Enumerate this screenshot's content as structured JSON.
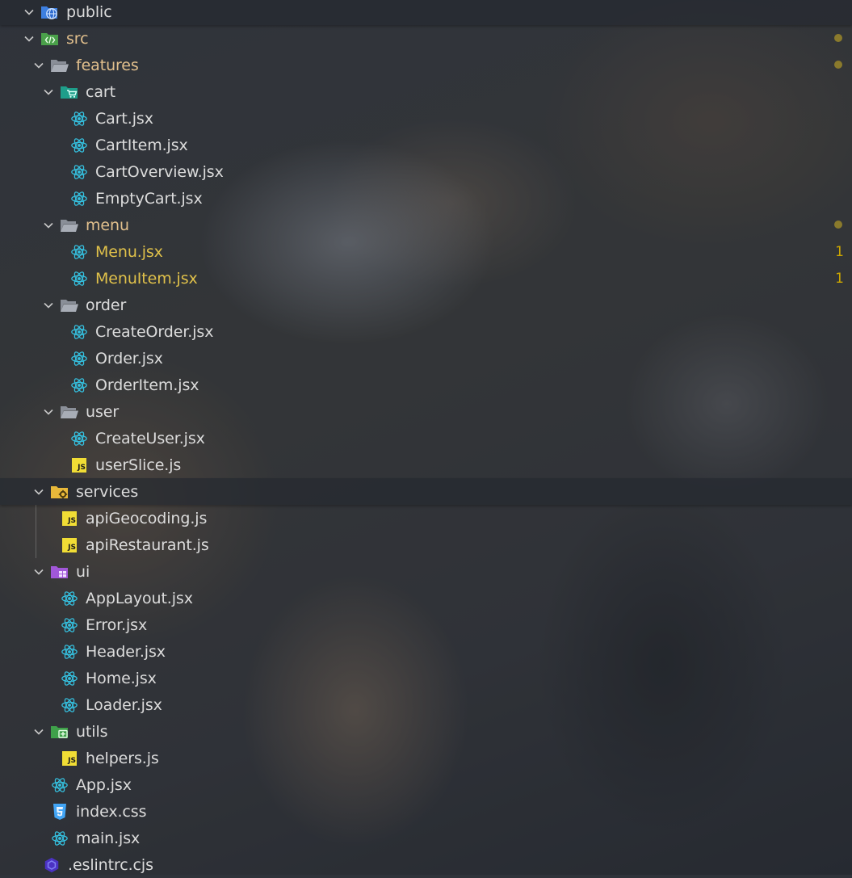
{
  "explorer": {
    "items": [
      {
        "label": "public",
        "type": "folder-public",
        "expanded": true,
        "depth": 0,
        "state": "normal"
      },
      {
        "label": "src",
        "type": "folder-src",
        "expanded": true,
        "depth": 0,
        "state": "modified"
      },
      {
        "label": "features",
        "type": "folder",
        "expanded": true,
        "depth": 1,
        "state": "modified"
      },
      {
        "label": "cart",
        "type": "folder-cart",
        "expanded": true,
        "depth": 2,
        "state": "normal"
      },
      {
        "label": "Cart.jsx",
        "type": "react",
        "depth": 3,
        "state": "normal"
      },
      {
        "label": "CartItem.jsx",
        "type": "react",
        "depth": 3,
        "state": "normal"
      },
      {
        "label": "CartOverview.jsx",
        "type": "react",
        "depth": 3,
        "state": "normal"
      },
      {
        "label": "EmptyCart.jsx",
        "type": "react",
        "depth": 3,
        "state": "normal"
      },
      {
        "label": "menu",
        "type": "folder",
        "expanded": true,
        "depth": 2,
        "state": "modified"
      },
      {
        "label": "Menu.jsx",
        "type": "react",
        "depth": 3,
        "state": "warn",
        "badge": "1"
      },
      {
        "label": "MenuItem.jsx",
        "type": "react",
        "depth": 3,
        "state": "warn",
        "badge": "1"
      },
      {
        "label": "order",
        "type": "folder",
        "expanded": true,
        "depth": 2,
        "state": "normal"
      },
      {
        "label": "CreateOrder.jsx",
        "type": "react",
        "depth": 3,
        "state": "normal"
      },
      {
        "label": "Order.jsx",
        "type": "react",
        "depth": 3,
        "state": "normal"
      },
      {
        "label": "OrderItem.jsx",
        "type": "react",
        "depth": 3,
        "state": "normal"
      },
      {
        "label": "user",
        "type": "folder",
        "expanded": true,
        "depth": 2,
        "state": "normal"
      },
      {
        "label": "CreateUser.jsx",
        "type": "react",
        "depth": 3,
        "state": "normal"
      },
      {
        "label": "userSlice.js",
        "type": "js",
        "depth": 3,
        "state": "normal"
      },
      {
        "label": "services",
        "type": "folder-services",
        "expanded": true,
        "depth": 1,
        "state": "normal"
      },
      {
        "label": "apiGeocoding.js",
        "type": "js",
        "depth": 2,
        "state": "normal"
      },
      {
        "label": "apiRestaurant.js",
        "type": "js",
        "depth": 2,
        "state": "normal"
      },
      {
        "label": "ui",
        "type": "folder-ui",
        "expanded": true,
        "depth": 1,
        "state": "normal"
      },
      {
        "label": "AppLayout.jsx",
        "type": "react",
        "depth": 2,
        "state": "normal"
      },
      {
        "label": "Error.jsx",
        "type": "react",
        "depth": 2,
        "state": "normal"
      },
      {
        "label": "Header.jsx",
        "type": "react",
        "depth": 2,
        "state": "normal"
      },
      {
        "label": "Home.jsx",
        "type": "react",
        "depth": 2,
        "state": "normal"
      },
      {
        "label": "Loader.jsx",
        "type": "react",
        "depth": 2,
        "state": "normal"
      },
      {
        "label": "utils",
        "type": "folder-utils",
        "expanded": true,
        "depth": 1,
        "state": "normal"
      },
      {
        "label": "helpers.js",
        "type": "js",
        "depth": 2,
        "state": "normal"
      },
      {
        "label": "App.jsx",
        "type": "react",
        "depth": 1,
        "state": "normal"
      },
      {
        "label": "index.css",
        "type": "css",
        "depth": 1,
        "state": "normal"
      },
      {
        "label": "main.jsx",
        "type": "react",
        "depth": 1,
        "state": "normal"
      },
      {
        "label": ".eslintrc.cjs",
        "type": "eslint",
        "depth": 0,
        "state": "normal"
      }
    ]
  },
  "colors": {
    "react": "#35c0df",
    "js": "#f1dd35",
    "modified": "#e2c08d",
    "warn": "#e0c14a",
    "badge": "#cca700"
  }
}
